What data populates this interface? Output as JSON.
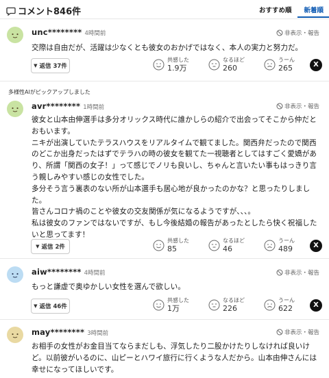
{
  "header": {
    "title": "コメント846件",
    "sort_recommended": "おすすめ順",
    "sort_newest": "新着順"
  },
  "colors": {
    "accent": "#0f5bb3",
    "avatar_green": "#c9e3a2",
    "avatar_blue": "#bcdcf3",
    "avatar_tan": "#e9d9a2"
  },
  "comments": [
    {
      "pickup": "",
      "username": "unc********",
      "time": "4時間前",
      "hide_report": "非表示・報告",
      "lines": [
        "交際は自由だが、活躍は少なくとも彼女のおかげではなく、本人の実力と努力だ。"
      ],
      "reply_label": "返信 37件",
      "reactions": [
        {
          "label": "共感した",
          "count": "1.9万",
          "icon": "smile-face-icon"
        },
        {
          "label": "なるほど",
          "count": "260",
          "icon": "thinking-face-icon"
        },
        {
          "label": "うーん",
          "count": "265",
          "icon": "hmm-face-icon"
        }
      ],
      "share": "X"
    },
    {
      "pickup": "多様性AIがピックアップしました",
      "username": "avr********",
      "time": "1時間前",
      "hide_report": "非表示・報告",
      "lines": [
        "彼女と山本由伸選手は多分オリックス時代に誰かしらの紹介で出会ってそこから仲だとおもいます。",
        "ニキが出演していたテラスハウスをリアルタイムで観てました。関西弁だったので関西のどこか出身だったはずでテラハの時の彼女を観てた一視聴者としてはすごく愛嬌があり、所謂「関西の女子！」って感じでノリも良いし、ちゃんと言いたい事もはっきり言う親しみやすい感じの女性でした。",
        "多分そう言う裏表のない所が山本選手も居心地が良かったのかな？と思ったりしました。",
        "皆さんコロナ禍のことや彼女の交友関係が気になるようですが、、、。",
        "私は彼女のファンではないですが、もし今後結婚の報告があったとしたら快く祝福したいと思ってます！"
      ],
      "reply_label": "返信 2件",
      "reactions": [
        {
          "label": "共感した",
          "count": "85",
          "icon": "smile-face-icon"
        },
        {
          "label": "なるほど",
          "count": "46",
          "icon": "thinking-face-icon"
        },
        {
          "label": "うーん",
          "count": "489",
          "icon": "hmm-face-icon"
        }
      ],
      "share": "X"
    },
    {
      "pickup": "",
      "username": "aiw********",
      "time": "4時間前",
      "hide_report": "非表示・報告",
      "lines": [
        "もっと謙虚で奥ゆかしい女性を選んで欲しい。"
      ],
      "reply_label": "返信 46件",
      "reactions": [
        {
          "label": "共感した",
          "count": "1万",
          "icon": "smile-face-icon"
        },
        {
          "label": "なるほど",
          "count": "226",
          "icon": "thinking-face-icon"
        },
        {
          "label": "うーん",
          "count": "622",
          "icon": "hmm-face-icon"
        }
      ],
      "share": "X"
    },
    {
      "pickup": "",
      "username": "may********",
      "time": "3時間前",
      "hide_report": "非表示・報告",
      "lines": [
        "お相手の女性がお金目当てならまだしも、浮気したり二股かけたりしなければ良いけど。以前彼がいるのに、山ピーとハワイ旅行に行くような人だから。山本由伸さんには幸せになってほしいです。"
      ],
      "reply_label": "",
      "reactions": [],
      "share": ""
    }
  ]
}
